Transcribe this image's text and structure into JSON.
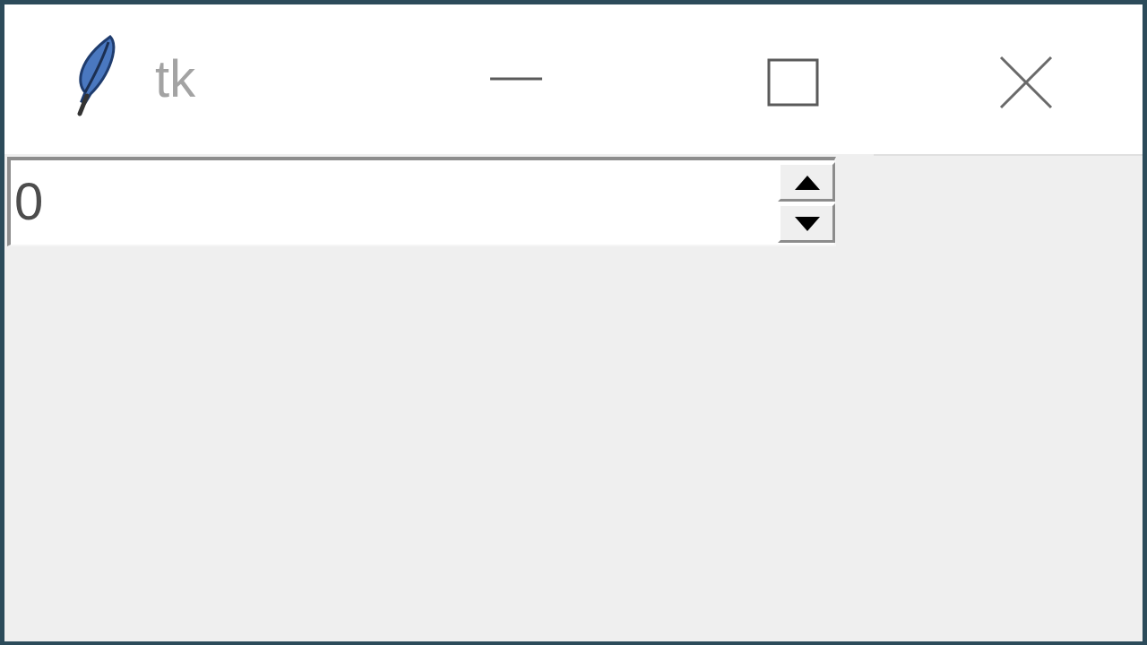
{
  "window": {
    "title": "tk",
    "icons": {
      "app": "tk-feather-icon",
      "minimize": "minimize-icon",
      "maximize": "maximize-icon",
      "close": "close-icon",
      "spin_up": "arrow-up-icon",
      "spin_down": "arrow-down-icon"
    }
  },
  "spinbox": {
    "value": "0"
  },
  "colors": {
    "frame": "#2c4b5a",
    "titlebar_bg": "#ffffff",
    "title_text": "#a3a3a3",
    "client_bg": "#efefef",
    "feather_blue": "#4a78c0"
  }
}
